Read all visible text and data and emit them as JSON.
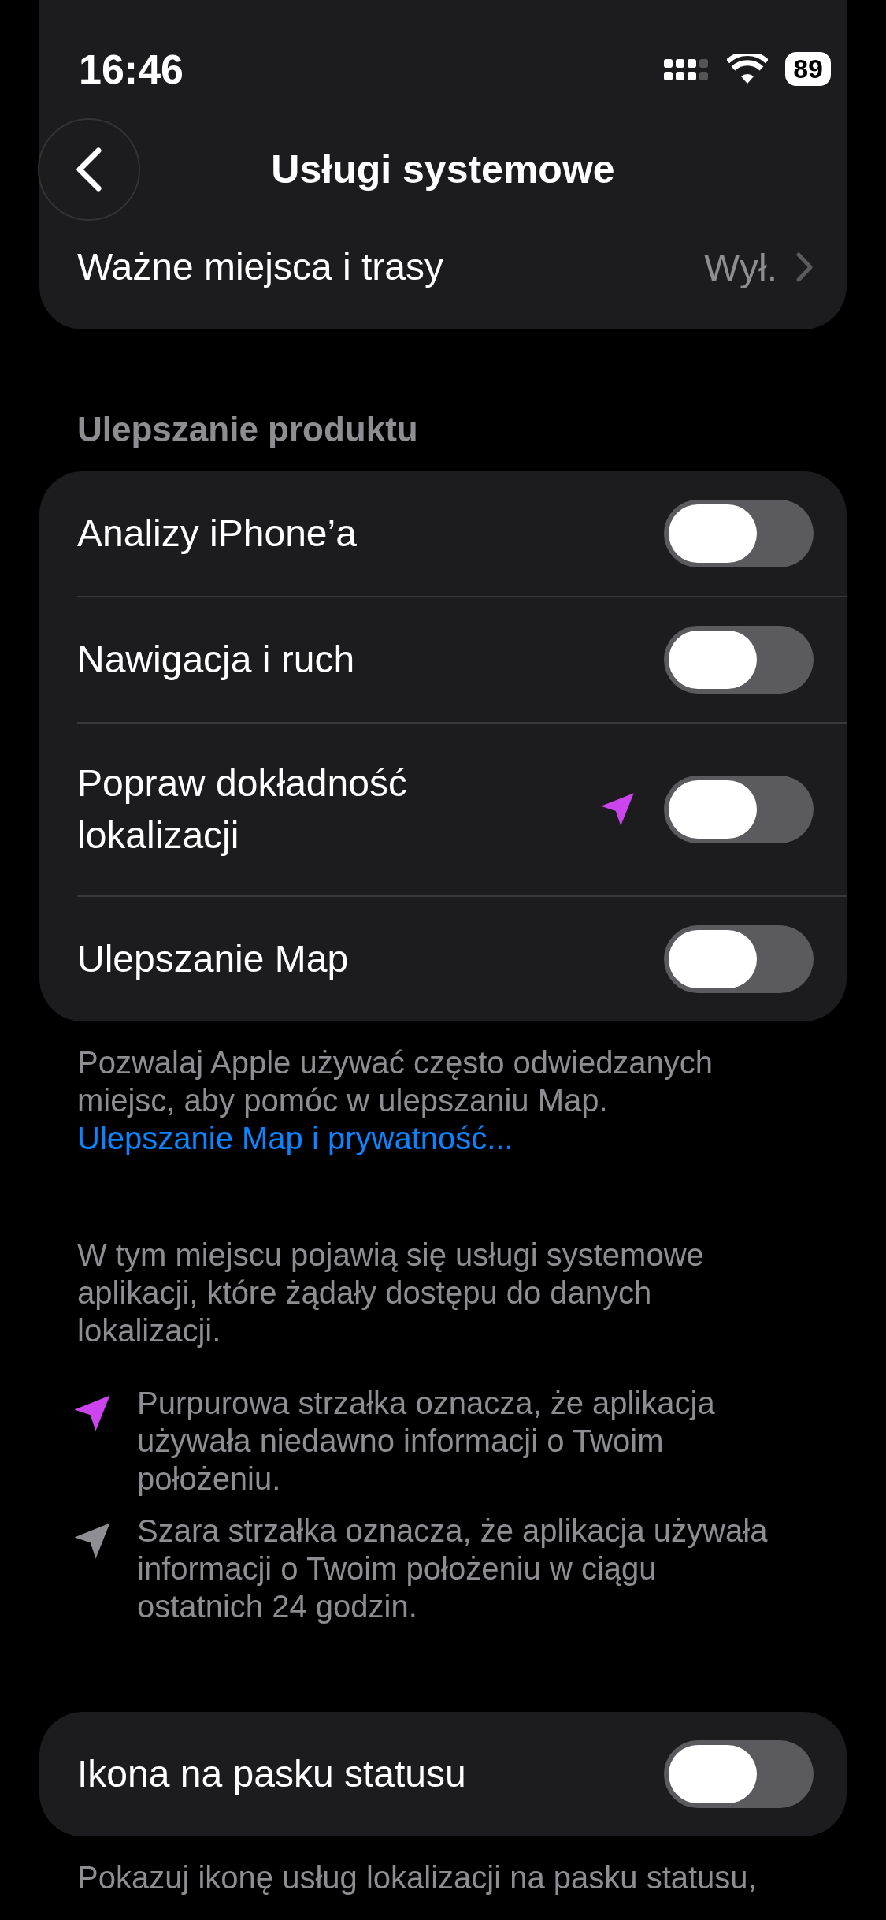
{
  "status_bar": {
    "time": "16:46",
    "battery": "89"
  },
  "nav": {
    "title": "Usługi systemowe"
  },
  "top_card": {
    "label": "Ważne miejsca i trasy",
    "value": "Wył."
  },
  "section": {
    "header": "Ulepszanie produktu",
    "rows": [
      {
        "label": "Analizy iPhone’a",
        "on": false
      },
      {
        "label": "Nawigacja i ruch",
        "on": false
      },
      {
        "label": "Popraw dokładność lokalizacji",
        "on": false,
        "color": "#cc44ee"
      },
      {
        "label": "Ulepszanie Map",
        "on": false
      }
    ],
    "footer": "Pozwalaj Apple używać często odwiedzanych miejsc, aby pomóc w ulepszaniu Map.",
    "footer_link": "Ulepszanie Map i prywatność..."
  },
  "info": "W tym miejscu pojawią się usługi systemowe aplikacji, które żądały dostępu do danych lokalizacji.",
  "legend": [
    {
      "color": "#cc44ee",
      "text": "Purpurowa strzałka oznacza, że aplikacja używała niedawno informacji o Twoim położeniu."
    },
    {
      "color": "#8e8e93",
      "text": "Szara strzałka oznacza, że aplikacja używała informacji o Twoim położeniu w ciągu ostatnich 24 godzin."
    }
  ],
  "status_icon": {
    "label": "Ikona na pasku statusu",
    "on": false,
    "footer": "Pokazuj ikonę usług lokalizacji na pasku statusu,"
  }
}
